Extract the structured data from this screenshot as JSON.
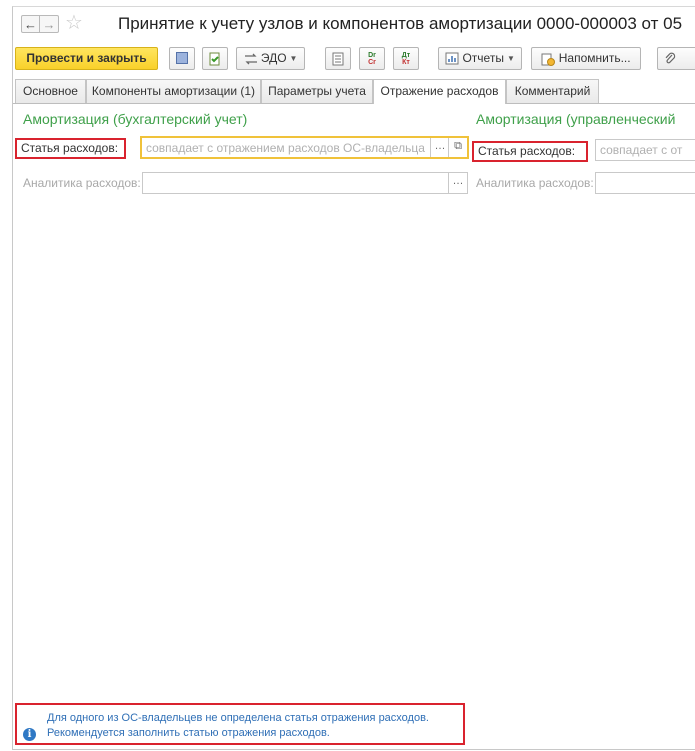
{
  "window": {
    "title": "Принятие к учету узлов и компонентов амортизации 0000-000003 от 05"
  },
  "nav": {
    "back": "←",
    "forward": "→",
    "favorite": "☆"
  },
  "toolbar": {
    "post_close": "Провести и закрыть",
    "edo": "ЭДО",
    "reports": "Отчеты",
    "remind": "Напомнить...",
    "dr_top": "Dr",
    "dr_bottom": "Cr",
    "dt_top": "Дт",
    "dt_bottom": "Кт"
  },
  "tabs": [
    {
      "label": "Основное"
    },
    {
      "label": "Компоненты амортизации (1)"
    },
    {
      "label": "Параметры учета"
    },
    {
      "label": "Отражение расходов"
    },
    {
      "label": "Комментарий"
    }
  ],
  "active_tab": "Отражение расходов",
  "accounting": {
    "section_title": "Амортизация (бухгалтерский учет)",
    "expense_item_label": "Статья расходов:",
    "expense_item_placeholder": "совпадает с отражением расходов ОС-владельца",
    "analytics_label": "Аналитика расходов:"
  },
  "management": {
    "section_title": "Амортизация (управленческий",
    "expense_item_label": "Статья расходов:",
    "expense_item_placeholder": "совпадает с от",
    "analytics_label": "Аналитика расходов:"
  },
  "message": {
    "line1": "Для одного из ОС-владельцев не определена статья отражения расходов.",
    "line2": "Рекомендуется заполнить статью отражения расходов."
  },
  "colors": {
    "accent_green": "#3fa04a",
    "highlight_red": "#d9232e",
    "primary_yellow": "#f9d12a",
    "info_blue": "#2f78c4"
  }
}
